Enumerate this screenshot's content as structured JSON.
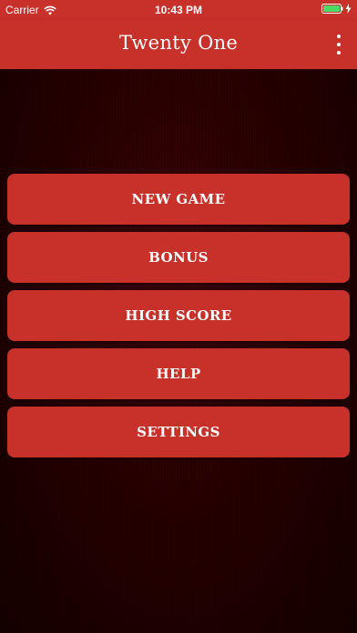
{
  "status_bar": {
    "carrier": "Carrier",
    "time": "10:43 PM",
    "icons": [
      "wifi-icon",
      "battery-icon",
      "charging-bolt-icon"
    ],
    "battery_color": "#4cd964"
  },
  "header": {
    "title": "Twenty One",
    "menu_icon": "more-vertical-icon"
  },
  "menu": {
    "items": [
      {
        "label": "NEW GAME"
      },
      {
        "label": "BONUS"
      },
      {
        "label": "HIGH SCORE"
      },
      {
        "label": "HELP"
      },
      {
        "label": "SETTINGS"
      }
    ]
  },
  "colors": {
    "accent": "#c8302a",
    "background": "#2a0000",
    "text": "#ffffff"
  }
}
